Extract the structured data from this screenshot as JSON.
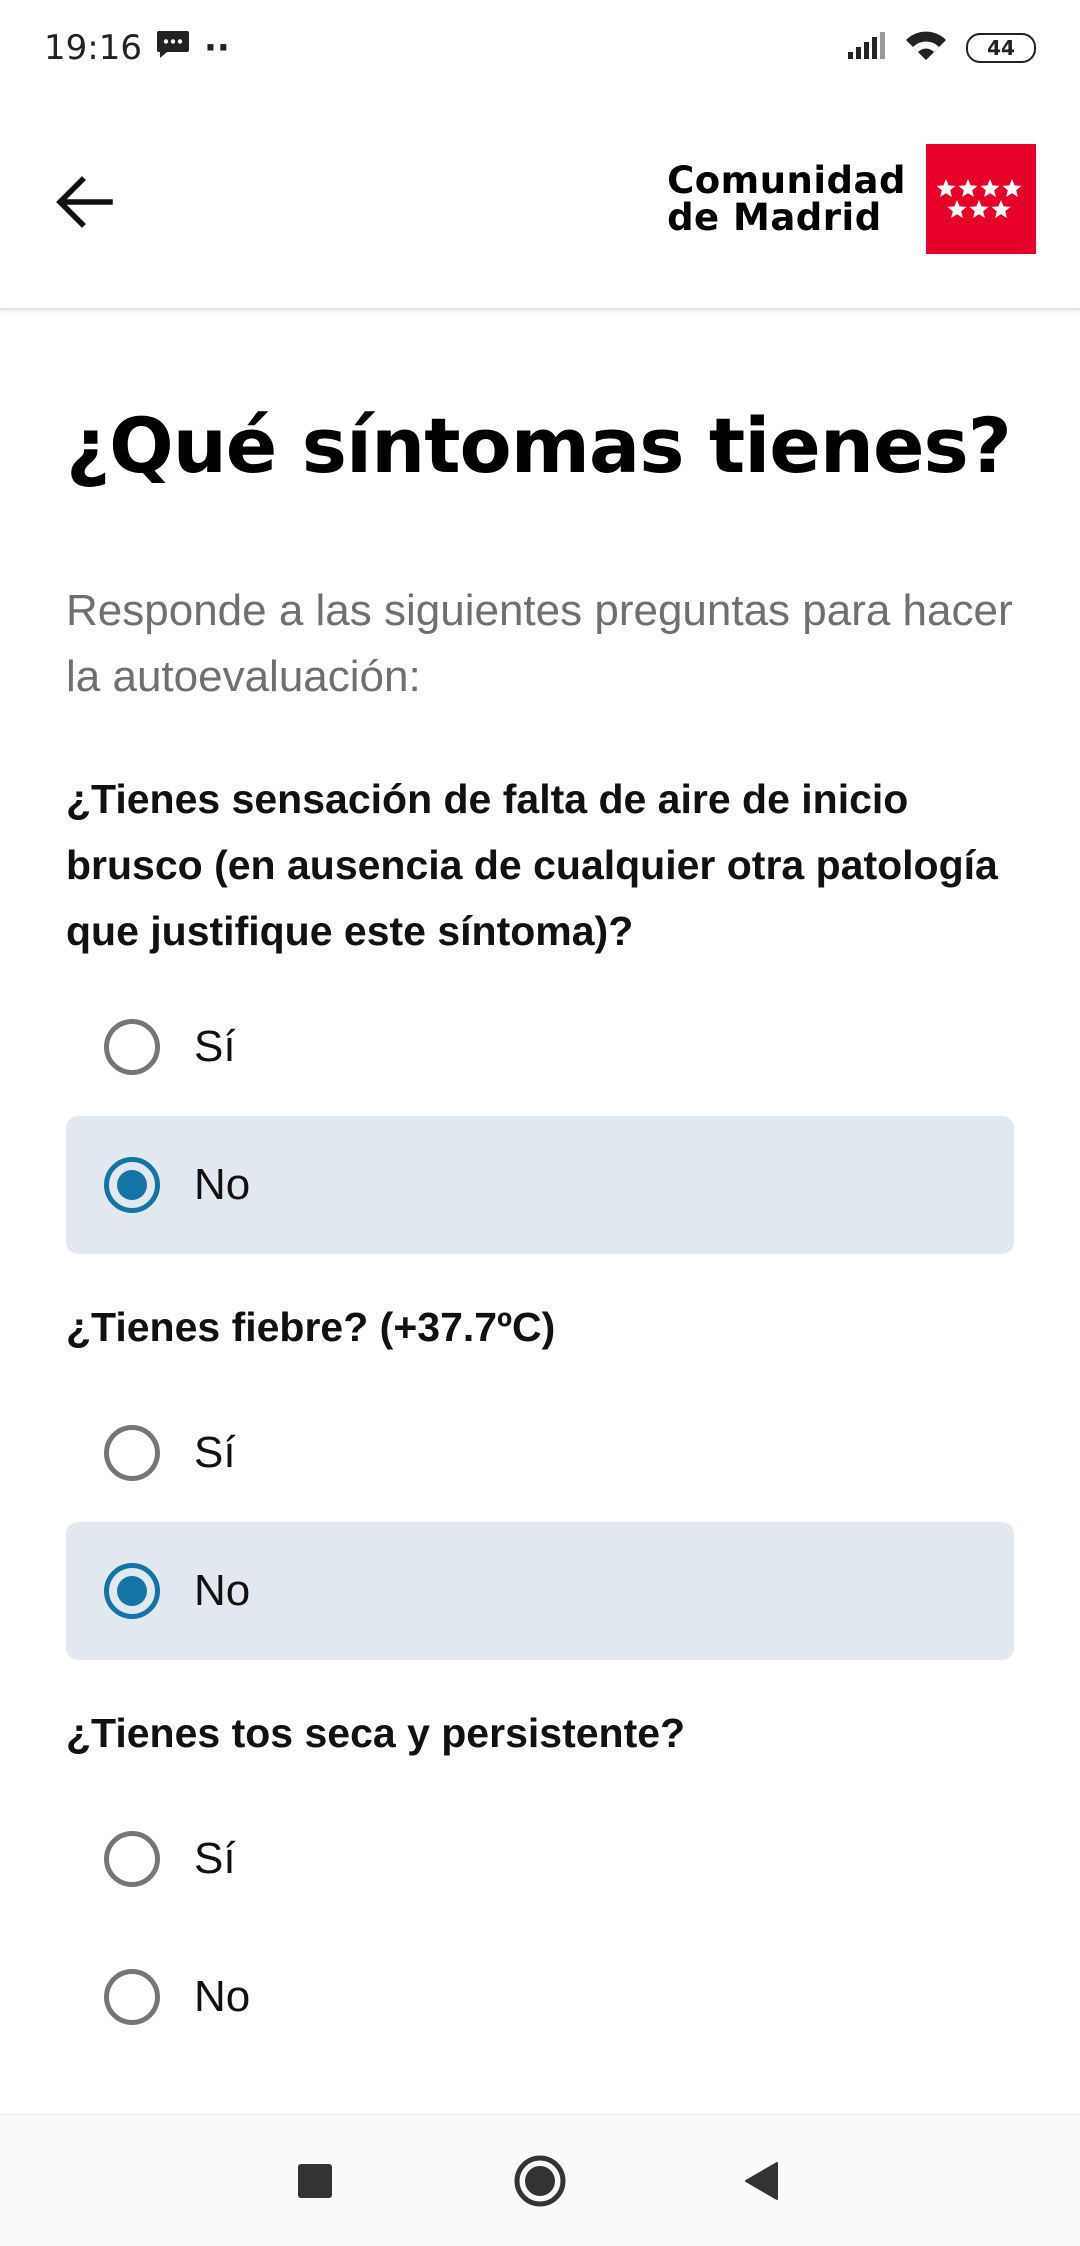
{
  "status_bar": {
    "time": "19:16",
    "extra_dots": "··",
    "battery": "44",
    "icons": [
      "message-icon",
      "signal-icon",
      "wifi-icon",
      "battery-icon"
    ]
  },
  "header": {
    "back_icon": "arrow-left-icon",
    "logo_line1": "Comunidad",
    "logo_line2": "de Madrid",
    "logo_color": "#e60029"
  },
  "page": {
    "title": "¿Qué síntomas tienes?",
    "intro": "Responde a las siguientes preguntas para hacer la autoevaluación:"
  },
  "questions": [
    {
      "text": "¿Tienes sensación de falta de aire de inicio brusco (en ausencia de cualquier otra patología que justifique este síntoma)?",
      "options": [
        "Sí",
        "No"
      ],
      "selected": "No"
    },
    {
      "text": "¿Tienes fiebre? (+37.7ºC)",
      "options": [
        "Sí",
        "No"
      ],
      "selected": "No"
    },
    {
      "text": "¿Tienes tos seca y persistente?",
      "options": [
        "Sí",
        "No"
      ],
      "selected": null
    }
  ],
  "colors": {
    "accent": "#1474a6",
    "selected_bg": "#e2e8f0",
    "intro_text": "#6f6f6f"
  },
  "nav_bar": {
    "icons": [
      "square-recents-icon",
      "circle-home-icon",
      "triangle-back-icon"
    ]
  }
}
